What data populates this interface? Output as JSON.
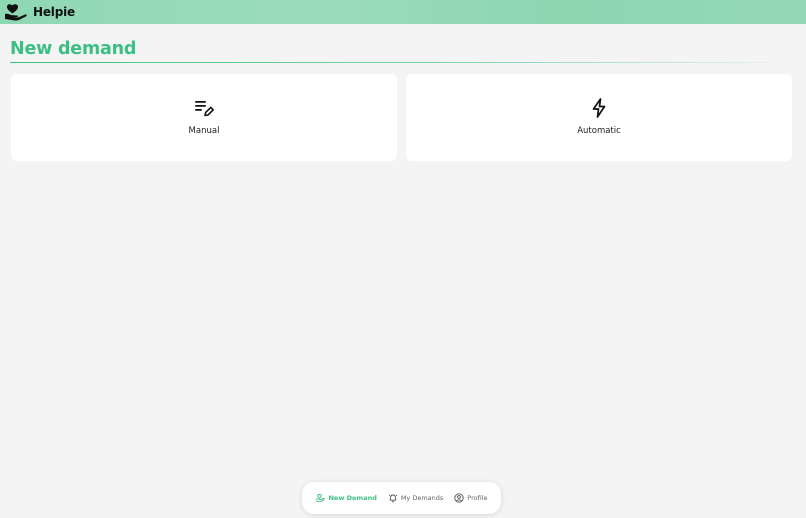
{
  "app": {
    "name": "Helpie",
    "logo_icon": "heart-hand-icon"
  },
  "page": {
    "title": "New demand"
  },
  "options": [
    {
      "label": "Manual",
      "icon": "list-edit-icon"
    },
    {
      "label": "Automatic",
      "icon": "lightning-icon"
    }
  ],
  "bottom_nav": [
    {
      "label": "New Demand",
      "icon": "hand-heart-icon",
      "active": true
    },
    {
      "label": "My Demands",
      "icon": "bell-icon",
      "active": false
    },
    {
      "label": "Profile",
      "icon": "user-circle-icon",
      "active": false
    }
  ],
  "colors": {
    "accent": "#3cbf82",
    "header": "#8fd8b4",
    "background": "#f4f4f5",
    "card": "#ffffff"
  }
}
